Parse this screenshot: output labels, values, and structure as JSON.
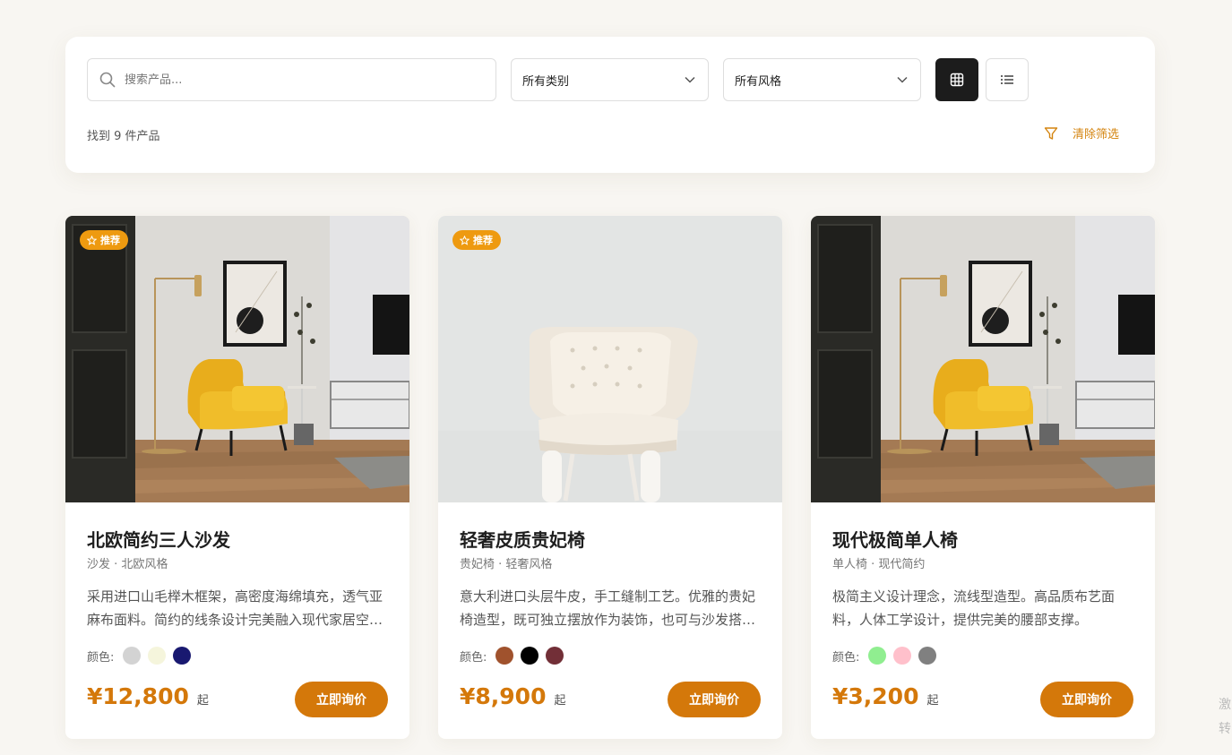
{
  "filters": {
    "search_placeholder": "搜索产品...",
    "category_selected": "所有类别",
    "style_selected": "所有风格",
    "result_count": "找到 9 件产品",
    "clear_label": "清除筛选"
  },
  "colors": {
    "accent": "#d4780a",
    "badge": "#ee9a10"
  },
  "products": [
    {
      "badge": "推荐",
      "name": "北欧简约三人沙发",
      "meta": "沙发 · 北欧风格",
      "description": "采用进口山毛榉木框架，高密度海绵填充，透气亚麻布面料。简约的线条设计完美融入现代家居空间。",
      "colors_label": "颜色:",
      "swatches": [
        "#d3d3d3",
        "#f5f5dc",
        "#191970"
      ],
      "price": "¥12,800",
      "price_suffix": "起",
      "button": "立即询价"
    },
    {
      "badge": "推荐",
      "name": "轻奢皮质贵妃椅",
      "meta": "贵妃椅 · 轻奢风格",
      "description": "意大利进口头层牛皮，手工缝制工艺。优雅的贵妃椅造型，既可独立摆放作为装饰，也可与沙发搭配使用。",
      "colors_label": "颜色:",
      "swatches": [
        "#a0522d",
        "#000000",
        "#722f37"
      ],
      "price": "¥8,900",
      "price_suffix": "起",
      "button": "立即询价"
    },
    {
      "badge": "",
      "name": "现代极简单人椅",
      "meta": "单人椅 · 现代简约",
      "description": "极简主义设计理念，流线型造型。高品质布艺面料，人体工学设计，提供完美的腰部支撑。",
      "colors_label": "颜色:",
      "swatches": [
        "#90ee90",
        "#ffc0cb",
        "#808080"
      ],
      "price": "¥3,200",
      "price_suffix": "起",
      "button": "立即询价"
    }
  ],
  "edge": {
    "line1": "激",
    "line2": "转"
  }
}
